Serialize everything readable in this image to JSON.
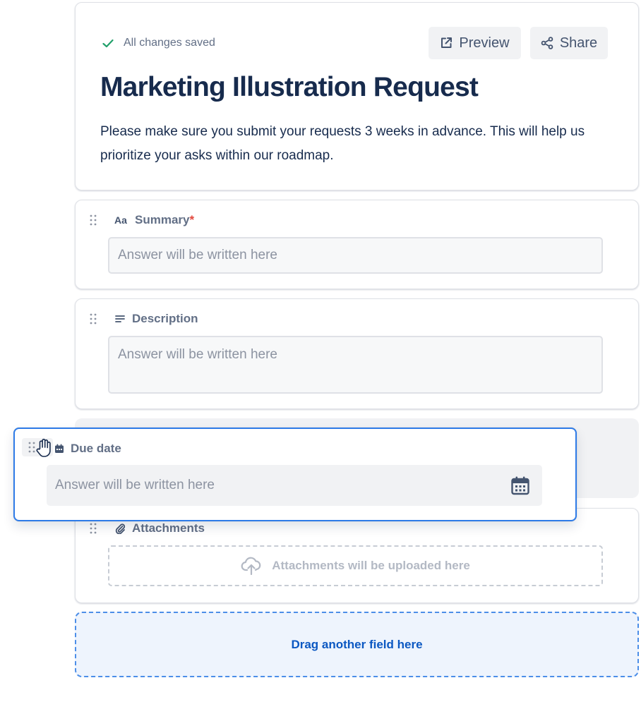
{
  "header": {
    "status_text": "All changes saved",
    "preview_label": "Preview",
    "share_label": "Share",
    "title": "Marketing Illustration Request",
    "description": "Please make sure you submit your requests 3 weeks in advance. This will help us prioritize your asks within our roadmap."
  },
  "fields": {
    "summary": {
      "label": "Summary",
      "required_mark": "*",
      "placeholder": "Answer will be written here",
      "icon": "text-type-icon"
    },
    "description": {
      "label": "Description",
      "placeholder": "Answer will be written here",
      "icon": "paragraph-icon"
    },
    "due_date": {
      "label": "Due date",
      "placeholder": "Answer will be written here",
      "icon": "calendar-icon"
    },
    "attachments": {
      "label": "Attachments",
      "upload_text": "Attachments will be uploaded here",
      "icon": "paperclip-icon"
    }
  },
  "drop_zone": {
    "text": "Drag another field here"
  },
  "colors": {
    "accent": "#2f7ce8",
    "required": "#e2483d",
    "success": "#22a06b",
    "drop_text": "#0c58c2"
  }
}
